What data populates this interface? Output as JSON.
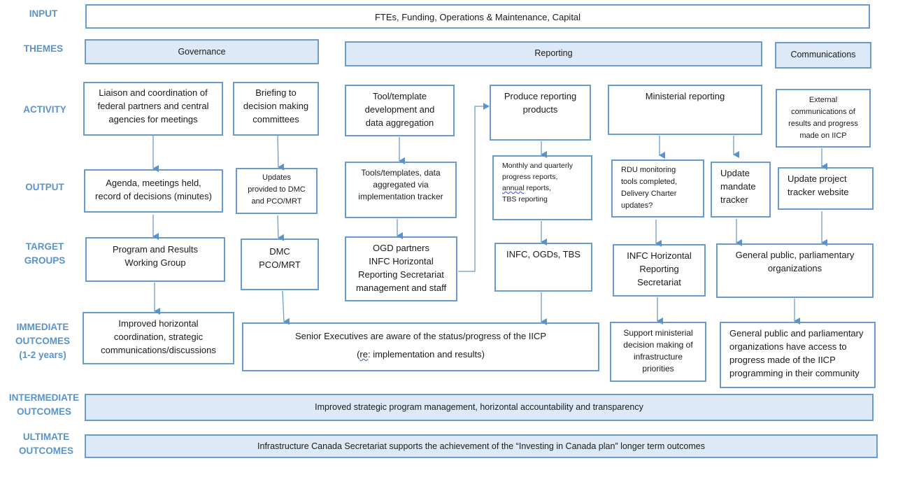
{
  "row_labels": {
    "input": "INPUT",
    "themes": "THEMES",
    "activity": "ACTIVITY",
    "output": "OUTPUT",
    "target_groups": "TARGET\nGROUPS",
    "immediate_outcomes": "IMMEDIATE\nOUTCOMES\n(1-2 years)",
    "intermediate_outcomes": "INTERMEDIATE\nOUTCOMES",
    "ultimate_outcomes": "ULTIMATE\nOUTCOMES"
  },
  "input": "FTEs, Funding, Operations & Maintenance, Capital",
  "themes": {
    "governance": "Governance",
    "reporting": "Reporting",
    "communications": "Communications"
  },
  "activities": {
    "liaison": "Liaison and coordination of\nfederal partners and central\nagencies for meetings",
    "briefing": "Briefing to\ndecision making\ncommittees",
    "tool_template": "Tool/template\ndevelopment and\ndata aggregation",
    "produce_reporting": "Produce reporting\nproducts",
    "ministerial": "Ministerial reporting",
    "external_comms": "External\ncommunications of\nresults and progress\nmade on IICP"
  },
  "outputs": {
    "agenda": "Agenda, meetings held,\nrecord of decisions (minutes)",
    "updates_dmc": "Updates\nprovided to DMC\nand PCO/MRT",
    "tools_templates": "Tools/templates, data\naggregated via\nimplementation tracker",
    "monthly_reports_1": "Monthly and quarterly\nprogress reports,",
    "monthly_reports_annual": "annual",
    "monthly_reports_2": " reports,\nTBS reporting",
    "rdu": "RDU monitoring\ntools completed,\nDelivery Charter\nupdates?",
    "mandate_tracker": "Update\nmandate\ntracker",
    "project_tracker": "Update project\ntracker website"
  },
  "target_groups": {
    "prwg": "Program and Results\nWorking Group",
    "dmc": "DMC\nPCO/MRT",
    "ogd": "OGD partners\nINFC Horizontal\nReporting Secretariat\nmanagement and staff",
    "infc_ogds_tbs": "INFC, OGDs, TBS",
    "infc_hrs": "INFC Horizontal\nReporting\nSecretariat",
    "general_public": "General public, parliamentary\norganizations"
  },
  "immediate_outcomes": {
    "improved_horizontal": "Improved horizontal\ncoordination, strategic\ncommunications/discussions",
    "senior_exec_line1": "Senior Executives are aware of the status/progress of the IICP",
    "senior_exec_re": "re",
    "senior_exec_line2": ": implementation and results)",
    "senior_exec_open": "(",
    "support_ministerial": "Support ministerial\ndecision making of\ninfrastructure\npriorities",
    "general_public_access": "General public and parliamentary\norganizations have access to\nprogress made of the IICP\nprogramming in their community"
  },
  "intermediate_outcome": "Improved strategic program management, horizontal accountability and transparency",
  "ultimate_outcome": "Infrastructure Canada Secretariat supports the achievement of the “Investing in Canada plan” longer term outcomes",
  "colors": {
    "label_blue": "#5b93c9",
    "border_blue": "#6a9bcc",
    "fill_blue": "#dde9f6"
  }
}
